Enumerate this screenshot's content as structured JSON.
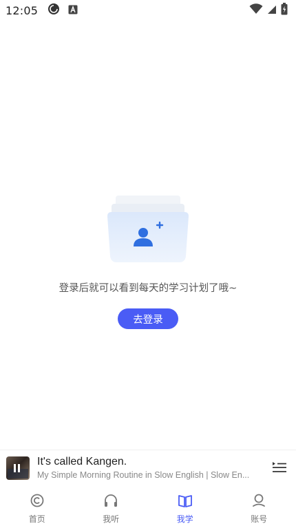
{
  "status_bar": {
    "time": "12:05"
  },
  "empty_state": {
    "message": "登录后就可以看到每天的学习计划了哦~",
    "login_label": "去登录"
  },
  "player": {
    "title": "It's called Kangen.",
    "subtitle": "My Simple Morning Routine in Slow English | Slow En..."
  },
  "nav": {
    "items": [
      {
        "label": "首页",
        "icon": "home-icon",
        "active": false
      },
      {
        "label": "我听",
        "icon": "headphones-icon",
        "active": false
      },
      {
        "label": "我学",
        "icon": "book-icon",
        "active": true
      },
      {
        "label": "账号",
        "icon": "account-icon",
        "active": false
      }
    ]
  },
  "colors": {
    "accent": "#4a5cf5",
    "inactive": "#777777"
  }
}
